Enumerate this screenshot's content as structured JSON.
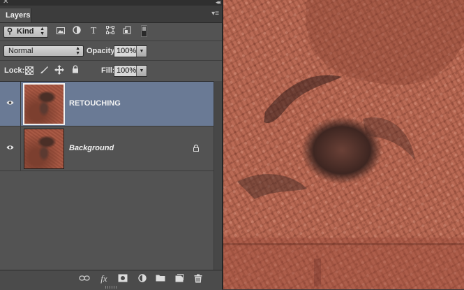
{
  "panel": {
    "tab_label": "Layers",
    "filter": {
      "kind_label": "Kind",
      "icons": [
        "image-filter-icon",
        "adjustment-filter-icon",
        "type-filter-icon",
        "shape-filter-icon",
        "smart-object-filter-icon"
      ]
    },
    "blend_mode": "Normal",
    "opacity_label": "Opacity:",
    "opacity_value": "100%",
    "lock_label": "Lock:",
    "fill_label": "Fill:",
    "fill_value": "100%",
    "layers": [
      {
        "name": "RETOUCHING",
        "selected": true,
        "visible": true,
        "locked": false
      },
      {
        "name": "Background",
        "selected": false,
        "visible": true,
        "locked": true
      }
    ],
    "bottom_icons": [
      "link-layers-icon",
      "fx-icon",
      "add-mask-icon",
      "adjustment-layer-icon",
      "new-group-icon",
      "new-layer-icon",
      "delete-icon"
    ],
    "fx_label": "fx"
  },
  "colors": {
    "panel_bg": "#535353",
    "selected_row": "#6a7a95",
    "canvas_tint": "#b86a54"
  }
}
